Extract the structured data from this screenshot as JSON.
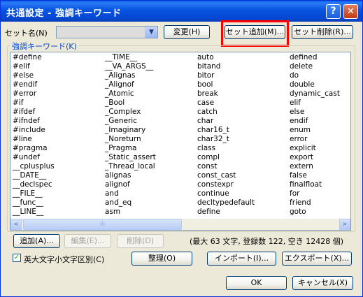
{
  "window": {
    "title": "共通設定 - 強調キーワード",
    "help_label": "?",
    "close_label": "✕"
  },
  "set_name": {
    "label": "セット名(N)",
    "selected": "",
    "arrow": "▼"
  },
  "buttons": {
    "change": "変更(H)",
    "add_set": "セット追加(M)...",
    "delete_set": "セット削除(R)...",
    "add": "追加(A)...",
    "edit": "編集(E)...",
    "delete": "削除(D)",
    "organize": "整理(O)",
    "import": "インポート(I)...",
    "export": "エクスポート(X)...",
    "ok": "OK",
    "cancel": "キャンセル(X)"
  },
  "keywords_group": {
    "label": "強調キーワード(K)"
  },
  "keywords": [
    [
      "#define",
      "#elif",
      "#else",
      "#endif",
      "#error",
      "#if",
      "#ifdef",
      "#ifndef",
      "#include",
      "#line",
      "#pragma",
      "#undef",
      "__cplusplus",
      "__DATE__",
      "__declspec",
      "__FILE__",
      "__func__",
      "__LINE__"
    ],
    [
      "__TIME__",
      "__VA_ARGS__",
      "_Alignas",
      "_Alignof",
      "_Atomic",
      "_Bool",
      "_Complex",
      "_Generic",
      "_Imaginary",
      "_Noreturn",
      "_Pragma",
      "_Static_assert",
      "_Thread_local",
      "alignas",
      "alignof",
      "and",
      "and_eq",
      "asm"
    ],
    [
      "auto",
      "bitand",
      "bitor",
      "bool",
      "break",
      "case",
      "catch",
      "char",
      "char16_t",
      "char32_t",
      "class",
      "compl",
      "const",
      "const_cast",
      "constexpr",
      "continue",
      "decltypedefault",
      "define"
    ],
    [
      "defined",
      "delete",
      "do",
      "double",
      "dynamic_cast",
      "elif",
      "else",
      "endif",
      "enum",
      "error",
      "explicit",
      "export",
      "extern",
      "false",
      "finalfloat",
      "for",
      "friend",
      "goto"
    ]
  ],
  "scroll": {
    "left_arrow": "<",
    "right_arrow": ">",
    "thumb_grip": "III"
  },
  "status": "(最大 63 文字, 登録数 122, 空き 12428 個)",
  "case_checkbox": {
    "label": "英大文字小文字区別(C)",
    "checked": true,
    "mark": "✓"
  },
  "colors": {
    "title_bar": "#0753e0",
    "dialog_bg": "#ece9d8",
    "highlight": "#ff0000",
    "group_label": "#0046d5"
  }
}
